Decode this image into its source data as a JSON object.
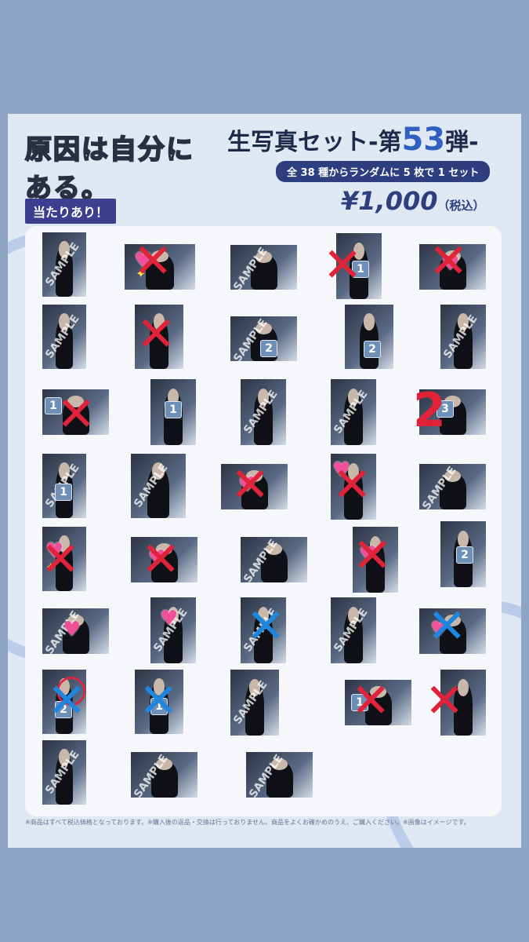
{
  "poster": {
    "logo_text": "原因は自分にある。",
    "badge": "当たりあり！",
    "title_prefix": "生写真セット",
    "title_dash1": "-",
    "title_mid": "第",
    "title_number": "53",
    "title_suffix": "弾",
    "title_dash2": "-",
    "subtitle": "全 38 種からランダムに 5 枚で 1 セット",
    "price": "¥1,000",
    "price_tax": "（税込）",
    "footer": "※商品はすべて税込価格となっております。※購入後の返品・交換は行っておりません。商品をよくお確かめのうえ、ご購入ください。※画像はイメージです。"
  },
  "sample_watermark": "SAMPLE",
  "overlay_icons": {
    "heart": "heart-emoji",
    "sparkle": "sparkle-emoji",
    "number_box": "keycap-number"
  },
  "colors": {
    "background": "#8fa5c4",
    "poster": "#dfe8f3",
    "red_mark": "#e1233a",
    "blue_mark": "#1f86e0",
    "heart": "#f04f9a"
  },
  "numbers": {
    "one": "1",
    "two": "2",
    "three": "3"
  },
  "handwritten": {
    "two": "2"
  }
}
